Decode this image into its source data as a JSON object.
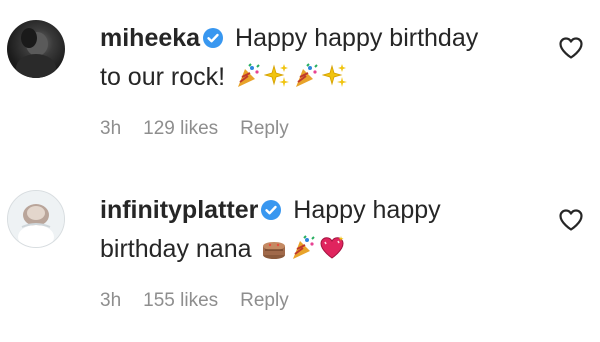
{
  "comments": [
    {
      "username": "miheeka",
      "line1": "Happy happy birthday",
      "line2": "to our rock!",
      "emojis": [
        "party-popper",
        "sparkles",
        "party-popper",
        "sparkles"
      ],
      "time": "3h",
      "likes": "129 likes",
      "reply": "Reply"
    },
    {
      "username": "infinityplatter",
      "line1": "Happy happy",
      "line2": "birthday nana",
      "emojis": [
        "cake",
        "party-popper",
        "sparkling-heart"
      ],
      "time": "3h",
      "likes": "155 likes",
      "reply": "Reply"
    }
  ],
  "colors": {
    "text": "#262626",
    "muted": "#8e8e8e",
    "verified": "#3897f0",
    "heart_icon": "#262626"
  }
}
